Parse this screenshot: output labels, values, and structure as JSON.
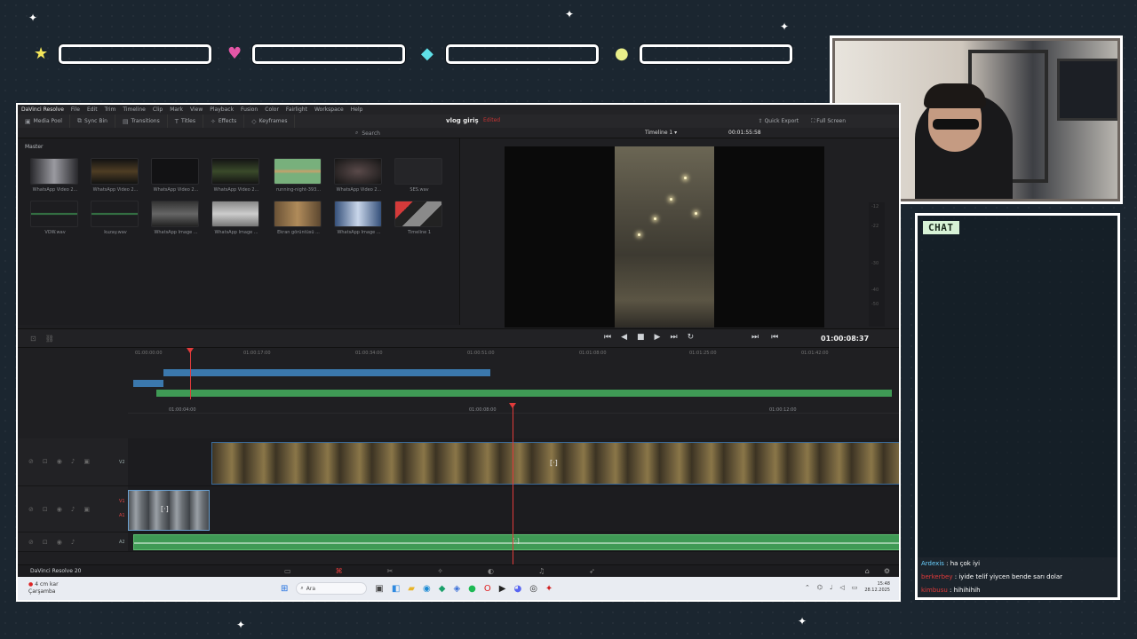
{
  "overlay": {
    "chat_title": "CHAT",
    "chat_messages": [
      {
        "user": "Ardexis",
        "text": "ha çok iyi"
      },
      {
        "user": "berkerbey",
        "text": "iyide telif yiycen bende sarı dolar"
      },
      {
        "user": "kimbusu",
        "text": "hihihihih"
      }
    ],
    "pixel_icons": [
      "star-icon",
      "heart-icon",
      "diamond-icon",
      "coin-icon"
    ]
  },
  "resolve": {
    "menu": [
      "DaVinci Resolve",
      "File",
      "Edit",
      "Trim",
      "Timeline",
      "Clip",
      "Mark",
      "View",
      "Playback",
      "Fusion",
      "Color",
      "Fairlight",
      "Workspace",
      "Help"
    ],
    "toolbar": [
      "Media Pool",
      "Sync Bin",
      "Transitions",
      "Titles",
      "Effects",
      "Keyframes"
    ],
    "project_title": "vlog giriş",
    "project_status": "Edited",
    "toolbar_right": [
      "Quick Export",
      "Full Screen"
    ],
    "search_label": "Search",
    "timeline_name": "Timeline 1",
    "top_timecode": "00:01:55:58",
    "bin_label": "Master",
    "clips": [
      {
        "name": "WhatsApp Video 2..."
      },
      {
        "name": "WhatsApp Video 2..."
      },
      {
        "name": "WhatsApp Video 2..."
      },
      {
        "name": "WhatsApp Video 2..."
      },
      {
        "name": "running-night-393..."
      },
      {
        "name": "WhatsApp Video 2..."
      },
      {
        "name": "SES.wav"
      },
      {
        "name": "VOW.wav"
      },
      {
        "name": "kuzay.wav"
      },
      {
        "name": "WhatsApp Image ..."
      },
      {
        "name": "WhatsApp Image ..."
      },
      {
        "name": "Ekran görüntüsü ..."
      },
      {
        "name": "WhatsApp Image ..."
      },
      {
        "name": "Timeline 1"
      }
    ],
    "main_timecode": "01:00:08:37",
    "mini_ruler": [
      "01:00:00:00",
      "01:00:17:00",
      "01:00:34:00",
      "01:00:51:00",
      "01:01:08:00",
      "01:01:25:00",
      "01:01:42:00"
    ],
    "main_ruler": [
      "01:00:04:00",
      "01:00:08:00",
      "01:00:12:00"
    ],
    "tracks": {
      "v2": "V2",
      "v1": "V1",
      "a1": "A1",
      "a2": "A2"
    },
    "app_name": "DaVinci Resolve 20"
  },
  "taskbar": {
    "weather_temp": "4 cm kar",
    "weather_day": "Çarşamba",
    "search_placeholder": "Ara",
    "time": "15:48",
    "date": "28.12.2025"
  }
}
